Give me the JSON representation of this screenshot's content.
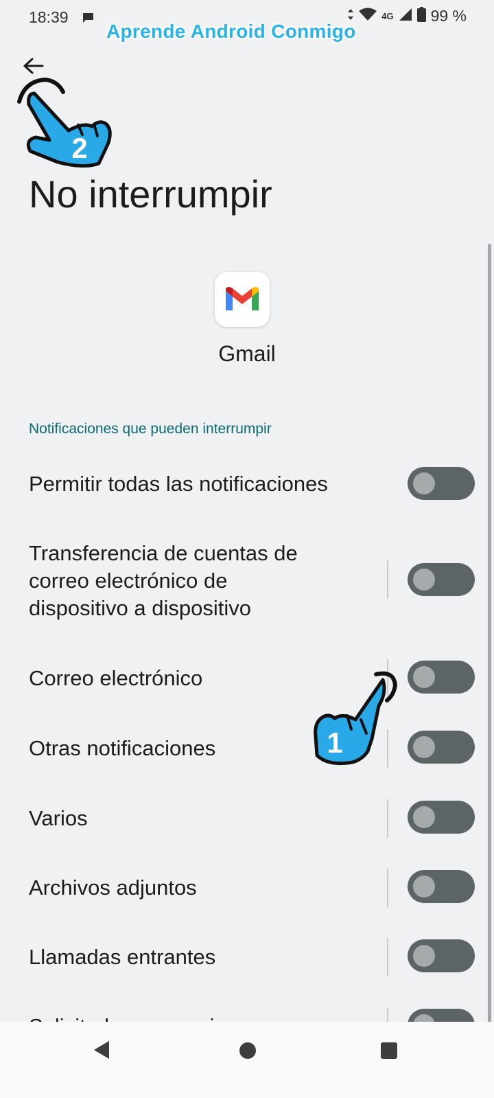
{
  "status_bar": {
    "time": "18:39",
    "network": "4G",
    "battery": "99 %",
    "icons": [
      "message-icon",
      "data-arrows-icon",
      "wifi-icon",
      "signal-icon",
      "battery-icon"
    ]
  },
  "watermark": "Aprende Android Conmigo",
  "header": {
    "title": "No interrumpir"
  },
  "app": {
    "name": "Gmail",
    "icon": "gmail-icon"
  },
  "section": {
    "header": "Notificaciones que pueden interrumpir"
  },
  "rows": [
    {
      "label": "Permitir todas las notificaciones",
      "enabled": false
    },
    {
      "label": "Transferencia de cuentas de correo electrónico de dispositivo a dispositivo",
      "enabled": false
    },
    {
      "label": "Correo electrónico",
      "enabled": false
    },
    {
      "label": "Otras notificaciones",
      "enabled": false
    },
    {
      "label": "Varios",
      "enabled": false
    },
    {
      "label": "Archivos adjuntos",
      "enabled": false
    },
    {
      "label": "Llamadas entrantes",
      "enabled": false
    },
    {
      "label": "Solicitudes para unirse",
      "enabled": false
    }
  ],
  "annotations": {
    "step1": "1",
    "step2": "2"
  },
  "colors": {
    "accent": "#27b3ec",
    "section_header": "#0b6a75",
    "toggle_track": "#5c6466",
    "toggle_thumb": "#a6aaab",
    "background": "#eff1f3"
  },
  "navbar": {
    "icons": [
      "back-triangle-icon",
      "home-circle-icon",
      "recents-square-icon"
    ]
  }
}
